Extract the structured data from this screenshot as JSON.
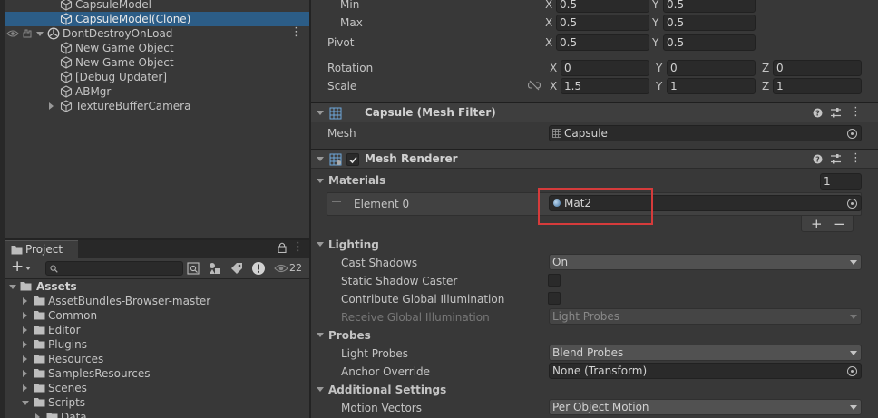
{
  "hierarchy": {
    "items": [
      {
        "label": "CapsuleModel"
      },
      {
        "label": "CapsuleModel(Clone)"
      },
      {
        "label": "DontDestroyOnLoad"
      },
      {
        "label": "New Game Object"
      },
      {
        "label": "New Game Object"
      },
      {
        "label": "[Debug Updater]"
      },
      {
        "label": "ABMgr"
      },
      {
        "label": "TextureBufferCamera"
      }
    ]
  },
  "project": {
    "tab_label": "Project",
    "search_placeholder": "",
    "hidden_count": "22",
    "tree": [
      {
        "label": "Assets"
      },
      {
        "label": "AssetBundles-Browser-master"
      },
      {
        "label": "Common"
      },
      {
        "label": "Editor"
      },
      {
        "label": "Plugins"
      },
      {
        "label": "Resources"
      },
      {
        "label": "SamplesResources"
      },
      {
        "label": "Scenes"
      },
      {
        "label": "Scripts"
      },
      {
        "label": "Data"
      }
    ]
  },
  "inspector": {
    "min": {
      "label": "Min",
      "x_axis": "X",
      "x": "0.5",
      "y_axis": "Y",
      "y": "0.5"
    },
    "max": {
      "label": "Max",
      "x_axis": "X",
      "x": "0.5",
      "y_axis": "Y",
      "y": "0.5"
    },
    "pivot": {
      "label": "Pivot",
      "x_axis": "X",
      "x": "0.5",
      "y_axis": "Y",
      "y": "0.5"
    },
    "rotation": {
      "label": "Rotation",
      "x_axis": "X",
      "x": "0",
      "y_axis": "Y",
      "y": "0",
      "z_axis": "Z",
      "z": "0"
    },
    "scale": {
      "label": "Scale",
      "x_axis": "X",
      "x": "1.5",
      "y_axis": "Y",
      "y": "1",
      "z_axis": "Z",
      "z": "1"
    },
    "mesh_filter": {
      "title": "Capsule (Mesh Filter)",
      "mesh_label": "Mesh",
      "mesh_value": "Capsule"
    },
    "mesh_renderer": {
      "title": "Mesh Renderer",
      "materials_label": "Materials",
      "materials_count": "1",
      "element_label": "Element 0",
      "element_value": "Mat2",
      "plus": "+",
      "minus": "−",
      "lighting_label": "Lighting",
      "cast_shadows_label": "Cast Shadows",
      "cast_shadows_value": "On",
      "static_shadow_label": "Static Shadow Caster",
      "contribute_gi_label": "Contribute Global Illumination",
      "receive_gi_label": "Receive Global Illumination",
      "receive_gi_value": "Light Probes",
      "probes_label": "Probes",
      "light_probes_label": "Light Probes",
      "light_probes_value": "Blend Probes",
      "anchor_label": "Anchor Override",
      "anchor_value": "None (Transform)",
      "additional_label": "Additional Settings",
      "motion_label": "Motion Vectors",
      "motion_value": "Per Object Motion"
    }
  },
  "colors": {
    "selection": "#2c5d87",
    "highlight_box": "#d63b3b",
    "panel": "#383838"
  }
}
